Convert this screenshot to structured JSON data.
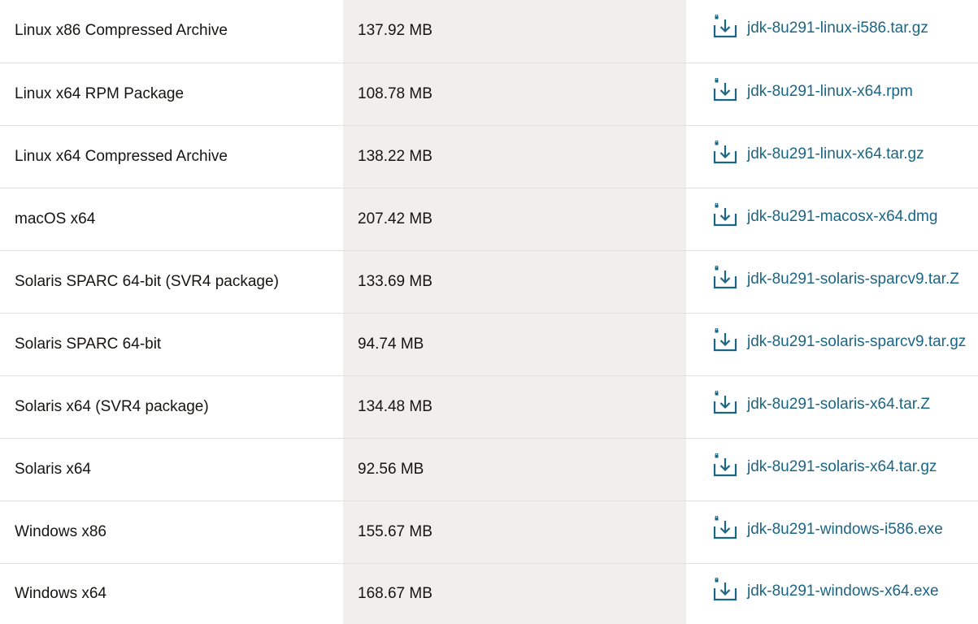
{
  "rows": [
    {
      "product": "Linux x86 Compressed Archive",
      "size": "137.92 MB",
      "file": "jdk-8u291-linux-i586.tar.gz"
    },
    {
      "product": "Linux x64 RPM Package",
      "size": "108.78 MB",
      "file": "jdk-8u291-linux-x64.rpm"
    },
    {
      "product": "Linux x64 Compressed Archive",
      "size": "138.22 MB",
      "file": "jdk-8u291-linux-x64.tar.gz"
    },
    {
      "product": "macOS x64",
      "size": "207.42 MB",
      "file": "jdk-8u291-macosx-x64.dmg"
    },
    {
      "product": "Solaris SPARC 64-bit (SVR4 package)",
      "size": "133.69 MB",
      "file": "jdk-8u291-solaris-sparcv9.tar.Z"
    },
    {
      "product": "Solaris SPARC 64-bit",
      "size": "94.74 MB",
      "file": "jdk-8u291-solaris-sparcv9.tar.gz"
    },
    {
      "product": "Solaris x64 (SVR4 package)",
      "size": "134.48 MB",
      "file": "jdk-8u291-solaris-x64.tar.Z"
    },
    {
      "product": "Solaris x64",
      "size": "92.56 MB",
      "file": "jdk-8u291-solaris-x64.tar.gz"
    },
    {
      "product": "Windows x86",
      "size": "155.67 MB",
      "file": "jdk-8u291-windows-i586.exe"
    },
    {
      "product": "Windows x64",
      "size": "168.67 MB",
      "file": "jdk-8u291-windows-x64.exe"
    }
  ],
  "icon": "locked-download-icon",
  "colors": {
    "link": "#1b6585",
    "size_column_bg": "#f0efed",
    "row_divider": "#e2e0dc",
    "text": "#161513"
  }
}
